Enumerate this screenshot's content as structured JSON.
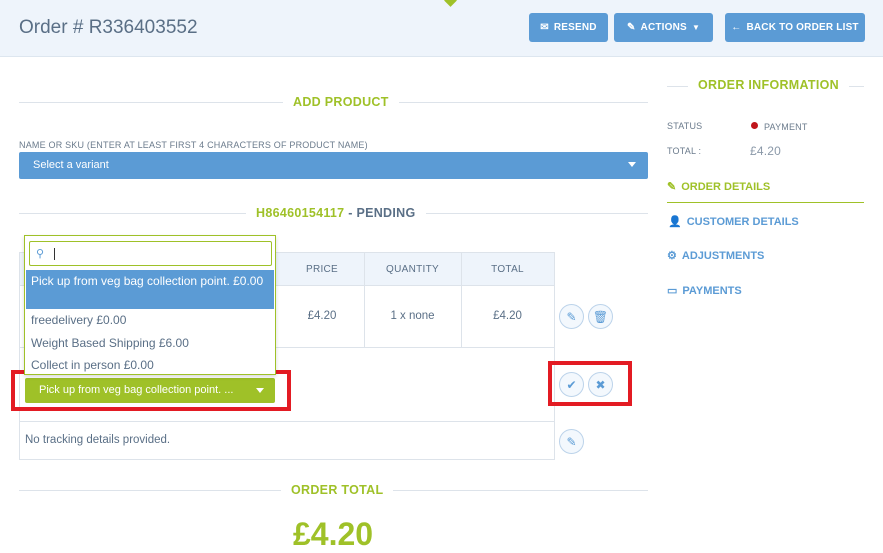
{
  "header": {
    "title": "Order # R336403552",
    "resend_label": "RESEND",
    "actions_label": "ACTIONS",
    "back_label": "BACK TO ORDER LIST"
  },
  "add_product": {
    "title": "ADD PRODUCT",
    "field_label": "NAME OR SKU (ENTER AT LEAST FIRST 4 CHARACTERS OF PRODUCT NAME)",
    "select_placeholder": "Select a variant"
  },
  "shipment": {
    "number": "H86460154117",
    "separator": " - ",
    "state": "PENDING",
    "columns": [
      "PRICE",
      "QUANTITY",
      "TOTAL"
    ],
    "row": {
      "price": "£4.20",
      "quantity": "1 x none",
      "total": "£4.20"
    },
    "tracking_text": "No tracking details provided."
  },
  "shipping_dropdown": {
    "search_value": "",
    "options": [
      {
        "label": "Pick up from veg bag collection point. £0.00",
        "selected": true
      },
      {
        "label": "freedelivery £0.00",
        "selected": false
      },
      {
        "label": "Weight Based Shipping £6.00",
        "selected": false
      },
      {
        "label": "Collect in person £0.00",
        "selected": false
      }
    ],
    "selected_display": "Pick up from veg bag collection point. ..."
  },
  "order_total": {
    "title": "ORDER TOTAL",
    "amount": "£4.20"
  },
  "sidebar": {
    "title": "ORDER INFORMATION",
    "status_label": "STATUS",
    "status_value": "PAYMENT",
    "total_label": "TOTAL :",
    "total_value": "£4.20",
    "links": [
      {
        "label": "ORDER DETAILS",
        "icon": "edit-icon",
        "active": true
      },
      {
        "label": "CUSTOMER DETAILS",
        "icon": "user-icon",
        "active": false
      },
      {
        "label": "ADJUSTMENTS",
        "icon": "cogs-icon",
        "active": false
      },
      {
        "label": "PAYMENTS",
        "icon": "credit-card-icon",
        "active": false
      }
    ]
  },
  "colors": {
    "accent_green": "#9fc128",
    "primary_blue": "#5b9bd5",
    "highlight_red": "#e31b23",
    "status_dot": "#c0151b"
  }
}
